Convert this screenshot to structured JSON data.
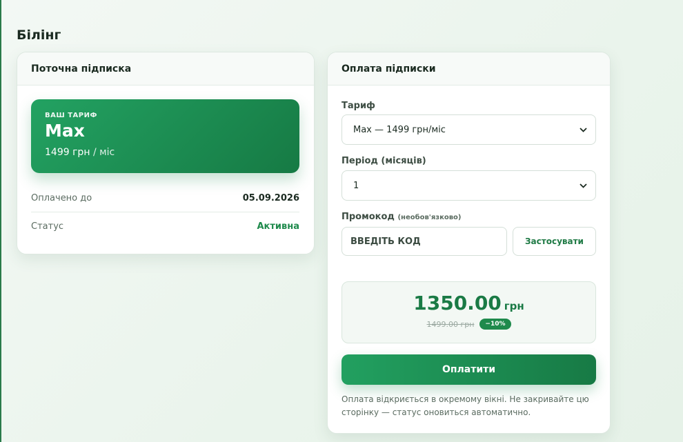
{
  "page": {
    "title": "Білінг"
  },
  "current": {
    "header": "Поточна підписка",
    "plan_caption": "ВАШ ТАРИФ",
    "plan_name": "Max",
    "plan_price": "1499 грн",
    "plan_unit": "/ міс",
    "paid_until_label": "Оплачено до",
    "paid_until_value": "05.09.2026",
    "status_label": "Статус",
    "status_value": "Активна"
  },
  "payment": {
    "header": "Оплата підписки",
    "tariff_label": "Тариф",
    "tariff_selected": "Max — 1499 грн/міс",
    "period_label": "Період (місяців)",
    "period_selected": "1",
    "promo_label": "Промокод",
    "promo_hint": "(необов'язково)",
    "promo_placeholder": "ВВЕДІТЬ КОД",
    "apply_label": "Застосувати",
    "total_amount": "1350.00",
    "total_currency": "грн",
    "old_price": "1499.00 грн",
    "discount": "−10%",
    "pay_label": "Оплатити",
    "note": "Оплата відкриється в окремому вікні. Не закривайте цю сторінку — статус оновиться автоматично."
  },
  "colors": {
    "accent": "#1f8a4c",
    "accent_dark": "#167a44"
  },
  "icons": {
    "select_arrow": "chevron-down-icon"
  }
}
